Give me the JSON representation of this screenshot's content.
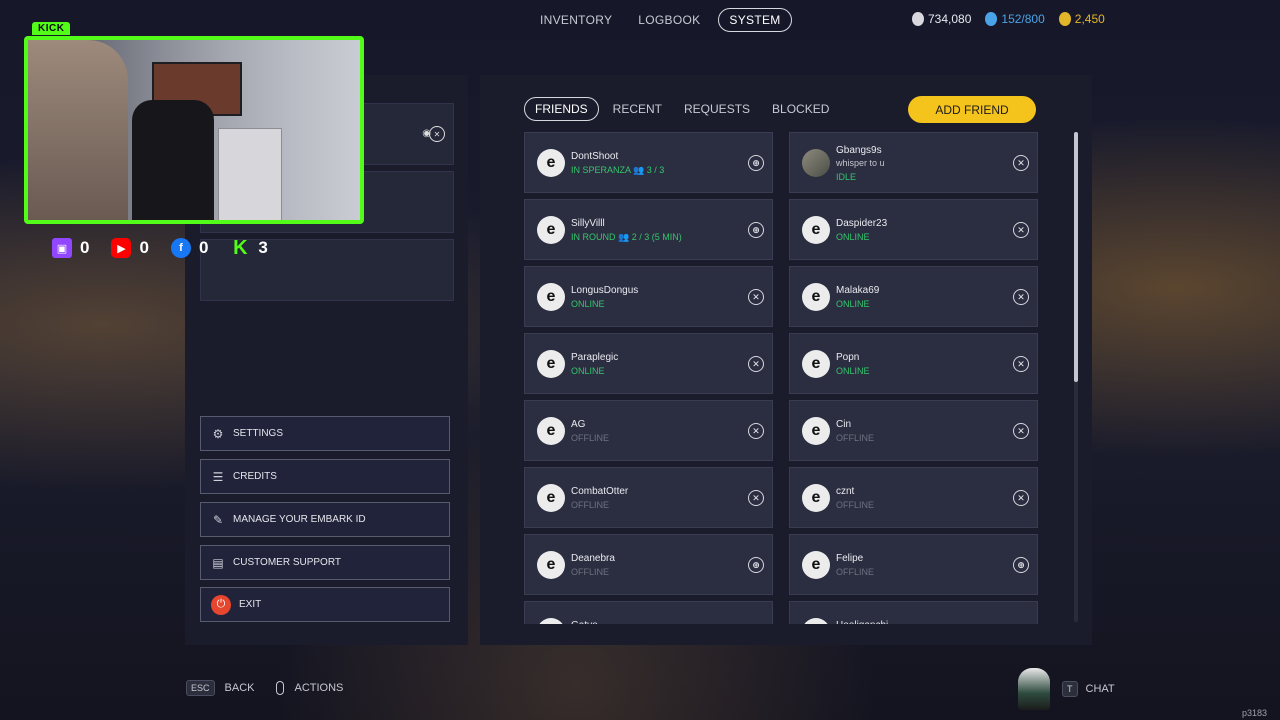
{
  "topnav": {
    "tabs": [
      "INVENTORY",
      "LOGBOOK",
      "SYSTEM"
    ],
    "active": "SYSTEM"
  },
  "currencies": [
    {
      "value": "734,080",
      "icon": "credits-coin-icon",
      "color": "#d8d8de"
    },
    {
      "value": "152/800",
      "icon": "multibucks-icon",
      "color": "#4aa3e6"
    },
    {
      "value": "2,450",
      "icon": "gold-coin-icon",
      "color": "#e2b52b"
    }
  ],
  "stream": {
    "badge": "KICK",
    "socials": [
      {
        "platform": "twitch",
        "count": "0",
        "color": "#9146ff"
      },
      {
        "platform": "youtube",
        "count": "0",
        "color": "#ff0000"
      },
      {
        "platform": "facebook",
        "count": "0",
        "color": "#1877f2"
      },
      {
        "platform": "kick",
        "count": "3",
        "color": "#53fc18"
      }
    ]
  },
  "menu": {
    "settings": "SETTINGS",
    "credits": "CREDITS",
    "manage_id": "MANAGE YOUR EMBARK ID",
    "support": "CUSTOMER SUPPORT",
    "exit": "EXIT"
  },
  "friends": {
    "tabs": [
      "FRIENDS",
      "RECENT",
      "REQUESTS",
      "BLOCKED"
    ],
    "active_tab": "FRIENDS",
    "add_friend": "ADD FRIEND",
    "list": [
      {
        "name": "DontShoot",
        "status": "IN SPERANZA 👥 3 / 3",
        "state": "online",
        "platform": "web"
      },
      {
        "name": "Gbangs9s",
        "sub": "whisper to u",
        "status": "IDLE",
        "state": "idle",
        "platform": "xbox",
        "photo": true
      },
      {
        "name": "SillyVilll",
        "status": "IN ROUND 👥 2 / 3 (5 MIN)",
        "state": "online",
        "platform": "web"
      },
      {
        "name": "Daspider23",
        "status": "ONLINE",
        "state": "online",
        "platform": "xbox"
      },
      {
        "name": "LongusDongus",
        "status": "ONLINE",
        "state": "online",
        "platform": "xbox"
      },
      {
        "name": "Malaka69",
        "status": "ONLINE",
        "state": "online",
        "platform": "xbox"
      },
      {
        "name": "Paraplegic",
        "status": "ONLINE",
        "state": "online",
        "platform": "xbox"
      },
      {
        "name": "Popn",
        "status": "ONLINE",
        "state": "online",
        "platform": "xbox"
      },
      {
        "name": "AG",
        "status": "OFFLINE",
        "state": "offline",
        "platform": "xbox"
      },
      {
        "name": "Cin",
        "status": "OFFLINE",
        "state": "offline",
        "platform": "xbox"
      },
      {
        "name": "CombatOtter",
        "status": "OFFLINE",
        "state": "offline",
        "platform": "xbox"
      },
      {
        "name": "cznt",
        "status": "OFFLINE",
        "state": "offline",
        "platform": "xbox"
      },
      {
        "name": "Deanebra",
        "status": "OFFLINE",
        "state": "offline",
        "platform": "web"
      },
      {
        "name": "Felipe",
        "status": "OFFLINE",
        "state": "offline",
        "platform": "web"
      },
      {
        "name": "Gatyo",
        "status": "",
        "state": "offline",
        "platform": "web"
      },
      {
        "name": "Hooliganchi",
        "status": "",
        "state": "offline",
        "platform": "web"
      }
    ]
  },
  "bottom": {
    "esc_key": "ESC",
    "back": "BACK",
    "actions": "ACTIONS",
    "chat_key": "T",
    "chat": "CHAT",
    "build": "p3183"
  }
}
